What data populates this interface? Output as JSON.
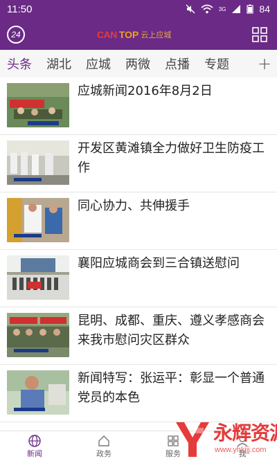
{
  "status_bar": {
    "time": "11:50",
    "battery": "84",
    "network": "3G"
  },
  "header": {
    "brand_latin_a": "CAN",
    "brand_latin_b": "TOP",
    "brand_cn": "云上应城",
    "badge_24": "24"
  },
  "tabs": [
    {
      "label": "头条"
    },
    {
      "label": "湖北"
    },
    {
      "label": "应城"
    },
    {
      "label": "两微"
    },
    {
      "label": "点播"
    },
    {
      "label": "专题"
    }
  ],
  "tab_plus": "+",
  "news": [
    {
      "title": "应城新闻2016年8月2日"
    },
    {
      "title": "开发区黄滩镇全力做好卫生防疫工作"
    },
    {
      "title": "同心协力、共伸援手"
    },
    {
      "title": "襄阳应城商会到三合镇送慰问"
    },
    {
      "title": "昆明、成都、重庆、遵义孝感商会来我市慰问灾区群众"
    },
    {
      "title": "新闻特写：张运平：彰显一个普通党员的本色"
    }
  ],
  "bottom_nav": [
    {
      "label": "新闻",
      "icon": "globe-icon"
    },
    {
      "label": "政务",
      "icon": "home-icon"
    },
    {
      "label": "服务",
      "icon": "grid-icon"
    },
    {
      "label": "我",
      "icon": "user-icon"
    }
  ],
  "watermark": {
    "text": "永辉资源网",
    "sub": "www.yhkjjj.com"
  },
  "colors": {
    "primary": "#6a2a86",
    "accent_red": "#e53a3a"
  }
}
